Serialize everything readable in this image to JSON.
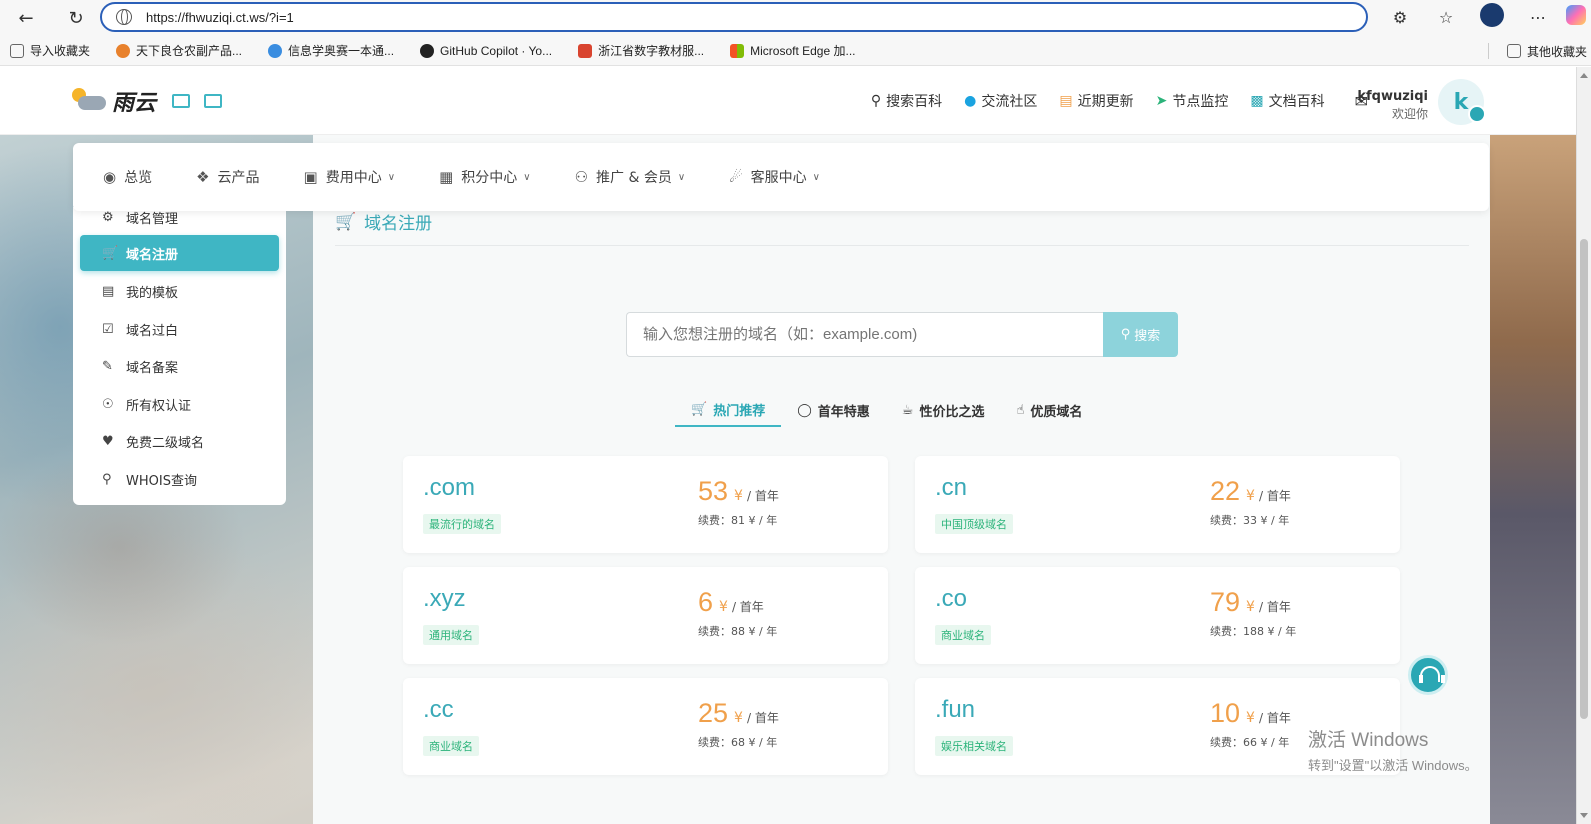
{
  "browser": {
    "url": "https://fhwuziqi.ct.ws/?i=1",
    "bookmarks": [
      {
        "label": "导入收藏夹",
        "color": "#666666"
      },
      {
        "label": "天下良仓农副产品...",
        "color": "#e8812c"
      },
      {
        "label": "信息学奥赛一本通...",
        "color": "#3a8de0"
      },
      {
        "label": "GitHub Copilot · Yo...",
        "color": "#222222"
      },
      {
        "label": "浙江省数字教材服...",
        "color": "#d9442f"
      },
      {
        "label": "Microsoft Edge 加...",
        "color": "#2f9e44"
      }
    ],
    "other_bookmarks": "其他收藏夹"
  },
  "site": {
    "logo_text": "雨云",
    "header_nav": [
      {
        "icon": "search-icon",
        "label": "搜索百科",
        "color": "#333333"
      },
      {
        "icon": "qq-icon",
        "label": "交流社区",
        "color": "#1aa3e0"
      },
      {
        "icon": "update-icon",
        "label": "近期更新",
        "color": "#f0a04b"
      },
      {
        "icon": "location-arrow-icon",
        "label": "节点监控",
        "color": "#2bb37a"
      },
      {
        "icon": "book-icon",
        "label": "文档百科",
        "color": "#2aa7b4"
      }
    ],
    "user": {
      "name": "kfqwuziqi",
      "welcome": "欢迎你",
      "avatar_letter": "k"
    }
  },
  "main_nav": [
    {
      "label": "总览",
      "icon": "dashboard-icon",
      "dropdown": false
    },
    {
      "label": "云产品",
      "icon": "cubes-icon",
      "dropdown": false
    },
    {
      "label": "费用中心",
      "icon": "money-icon",
      "dropdown": true
    },
    {
      "label": "积分中心",
      "icon": "gift-icon",
      "dropdown": true
    },
    {
      "label": "推广 & 会员",
      "icon": "users-icon",
      "dropdown": true
    },
    {
      "label": "客服中心",
      "icon": "headset-icon",
      "dropdown": true
    }
  ],
  "sidebar": {
    "items": [
      {
        "label": "域名管理",
        "icon": "cogs-icon",
        "active": false
      },
      {
        "label": "域名注册",
        "icon": "cart-icon",
        "active": true
      },
      {
        "label": "我的模板",
        "icon": "id-card-icon",
        "active": false
      },
      {
        "label": "域名过白",
        "icon": "check-square-icon",
        "active": false
      },
      {
        "label": "域名备案",
        "icon": "edit-icon",
        "active": false
      },
      {
        "label": "所有权认证",
        "icon": "user-check-icon",
        "active": false
      },
      {
        "label": "免费二级域名",
        "icon": "heart-icon",
        "active": false
      },
      {
        "label": "WHOIS查询",
        "icon": "search-icon",
        "active": false
      }
    ]
  },
  "content": {
    "title": "域名注册",
    "search": {
      "placeholder": "输入您想注册的域名（如：example.com)",
      "button": "搜索"
    },
    "tabs": [
      {
        "label": "热门推荐",
        "icon": "cart-icon",
        "active": true
      },
      {
        "label": "首年特惠",
        "icon": "tag-icon",
        "active": false
      },
      {
        "label": "性价比之选",
        "icon": "coffee-icon",
        "active": false
      },
      {
        "label": "优质域名",
        "icon": "thumbs-up-icon",
        "active": false
      }
    ],
    "domains": [
      {
        "tld": ".com",
        "tag": "最流行的域名",
        "price": "53",
        "currency": "¥",
        "per": "/ 首年",
        "renew": "续费：81 ¥ / 年"
      },
      {
        "tld": ".cn",
        "tag": "中国顶级域名",
        "price": "22",
        "currency": "¥",
        "per": "/ 首年",
        "renew": "续费：33 ¥ / 年"
      },
      {
        "tld": ".xyz",
        "tag": "通用域名",
        "price": "6",
        "currency": "¥",
        "per": "/ 首年",
        "renew": "续费：88 ¥ / 年"
      },
      {
        "tld": ".co",
        "tag": "商业域名",
        "price": "79",
        "currency": "¥",
        "per": "/ 首年",
        "renew": "续费：188 ¥ / 年"
      },
      {
        "tld": ".cc",
        "tag": "商业域名",
        "price": "25",
        "currency": "¥",
        "per": "/ 首年",
        "renew": "续费：68 ¥ / 年"
      },
      {
        "tld": ".fun",
        "tag": "娱乐相关域名",
        "price": "10",
        "currency": "¥",
        "per": "/ 首年",
        "renew": "续费：66 ¥ / 年"
      }
    ]
  },
  "watermark": {
    "line1": "激活 Windows",
    "line2": "转到\"设置\"以激活 Windows。"
  }
}
